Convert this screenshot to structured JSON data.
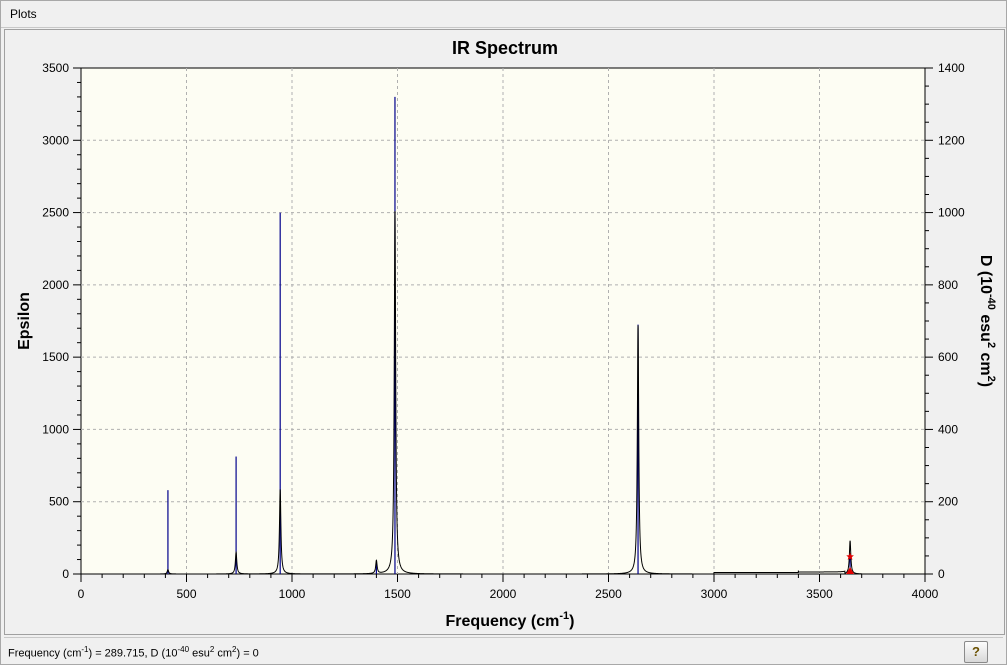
{
  "window": {
    "title": "Plots"
  },
  "chart_data": {
    "type": "line",
    "title": "IR Spectrum",
    "xlabel": "Frequency (cm⁻¹)",
    "xlabel_parts": {
      "base": "Frequency (cm",
      "sup": "-1",
      "tail": ")"
    },
    "ylabel": "Epsilon",
    "y2label": "D (10⁻⁴⁰ esu² cm²)",
    "y2label_parts": {
      "a": "D (10",
      "s1": "-40",
      "b": " esu",
      "s2": "2",
      "c": " cm",
      "s3": "2",
      "d": ")"
    },
    "xlim": [
      0,
      4000
    ],
    "ylim": [
      0,
      3500
    ],
    "y2lim": [
      0,
      1400
    ],
    "x_ticks": [
      "0",
      "500",
      "1000",
      "1500",
      "2000",
      "2500",
      "3000",
      "3500",
      "4000"
    ],
    "y_ticks": [
      "0",
      "500",
      "1000",
      "1500",
      "2000",
      "2500",
      "3000",
      "3500"
    ],
    "y2_ticks": [
      "0",
      "200",
      "400",
      "600",
      "800",
      "1000",
      "1200",
      "1400"
    ],
    "grid": true,
    "spectrum_range": [
      270,
      3700
    ],
    "plateau_segments": [
      {
        "x": [
          3000,
          3400
        ],
        "y": 10
      },
      {
        "x": [
          3400,
          3620
        ],
        "y": 14
      }
    ],
    "peaks": [
      {
        "x": 412,
        "epsilon": 30,
        "d": 232
      },
      {
        "x": 735,
        "epsilon": 150,
        "d": 325
      },
      {
        "x": 944,
        "epsilon": 585,
        "d": 1000
      },
      {
        "x": 1400,
        "epsilon": 90,
        "d": 28
      },
      {
        "x": 1488,
        "epsilon": 2510,
        "d": 1320
      },
      {
        "x": 2640,
        "epsilon": 1720,
        "d": 690
      },
      {
        "x": 3645,
        "epsilon": 230,
        "d": 48
      }
    ],
    "marker": {
      "x": 3645,
      "epsilon": 120,
      "d": 0
    },
    "colors": {
      "spectrum": "#000000",
      "sticks": "#00008b",
      "marker": "#e00000",
      "plot_bg": "#fdfdf3",
      "grid": "#b0b0b0"
    }
  },
  "status": {
    "parts": {
      "a": "Frequency (cm",
      "s1": "-1",
      "b": ") = 289.715, D (10",
      "s2": "-40",
      "c": " esu",
      "s3": "2",
      "d": " cm",
      "s4": "2",
      "e": ") = 0"
    }
  },
  "help": {
    "label": "?"
  }
}
